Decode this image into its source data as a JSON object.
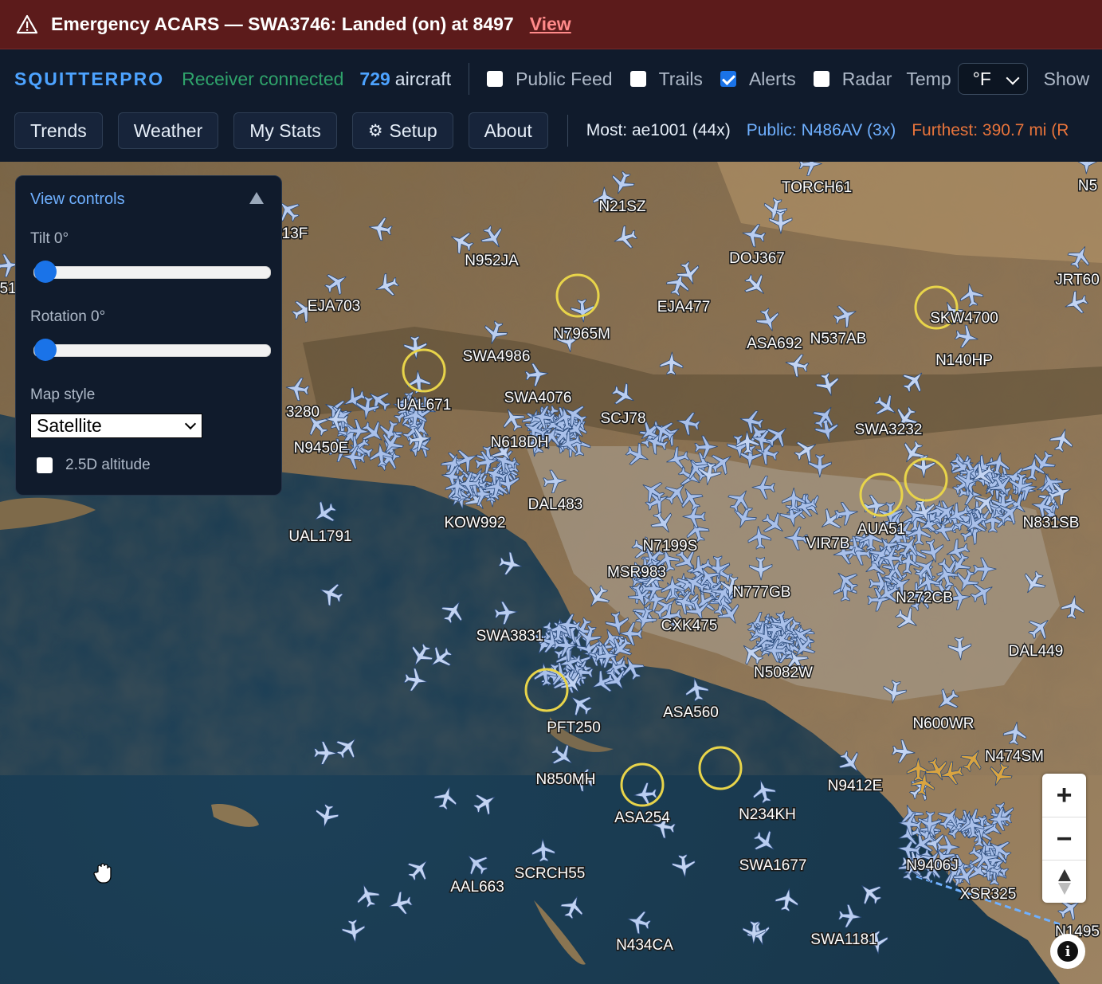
{
  "alert": {
    "message": "Emergency ACARS — SWA3746: Landed (on) at 8497",
    "link_label": "View",
    "icon": "warning-triangle-icon"
  },
  "header": {
    "brand": "SQUITTERPRO",
    "status": "Receiver connected",
    "aircraft_count": "729",
    "aircraft_label": "aircraft",
    "toggles": [
      {
        "label": "Public Feed",
        "checked": false
      },
      {
        "label": "Trails",
        "checked": false
      },
      {
        "label": "Alerts",
        "checked": true
      },
      {
        "label": "Radar",
        "checked": false
      }
    ],
    "temp_label": "Temp",
    "temp_value": "°F",
    "show_label": "Show"
  },
  "nav": {
    "buttons": [
      "Trends",
      "Weather",
      "My Stats",
      "Setup",
      "About"
    ],
    "most": "Most: ae1001 (44x)",
    "public": "Public: N486AV (3x)",
    "furthest": "Furthest: 390.7 mi (R"
  },
  "view_controls": {
    "title": "View controls",
    "tilt_label": "Tilt 0°",
    "tilt_value": 0,
    "rotation_label": "Rotation 0°",
    "rotation_value": 0,
    "map_style_label": "Map style",
    "map_style_value": "Satellite",
    "altitude_label": "2.5D altitude",
    "altitude_checked": false
  },
  "map": {
    "style": "Satellite",
    "flight_labels": [
      "N21SZ",
      "TORCH61",
      "N5",
      "13F",
      "N952JA",
      "DOJ367",
      "JRT60",
      "51",
      "EJA703",
      "N7965M",
      "EJA477",
      "SKW4700",
      "ASA692",
      "N537AB",
      "SWA4986",
      "N140HP",
      "UAL671",
      "SWA4076",
      "SCJ78",
      "3280",
      "SWA3232",
      "N618DH",
      "N9450E",
      "DAL483",
      "KOW992",
      "UAL1791",
      "AUA51",
      "N831SB",
      "N7199S",
      "VIR7B",
      "MSR983",
      "N777GB",
      "N272CB",
      "CXK475",
      "SWA3831",
      "DAL449",
      "N5082W",
      "ASA560",
      "PFT250",
      "N600WR",
      "N474SM",
      "N850MH",
      "N9412E",
      "ASA254",
      "N234KH",
      "SWA1677",
      "N9406J",
      "SCRCH55",
      "AAL663",
      "XSR325",
      "N434CA",
      "SWA1181",
      "N1495"
    ],
    "zoom_in": "+",
    "zoom_out": "−",
    "compass_icon": "compass-icon",
    "info_icon": "info-icon",
    "info_label": "i"
  },
  "colors": {
    "alert_bg": "#5c1b1b",
    "brand": "#4da3ff",
    "connected": "#2fa36b",
    "furthest": "#e8743b",
    "alert_ring": "#e8d44a"
  }
}
